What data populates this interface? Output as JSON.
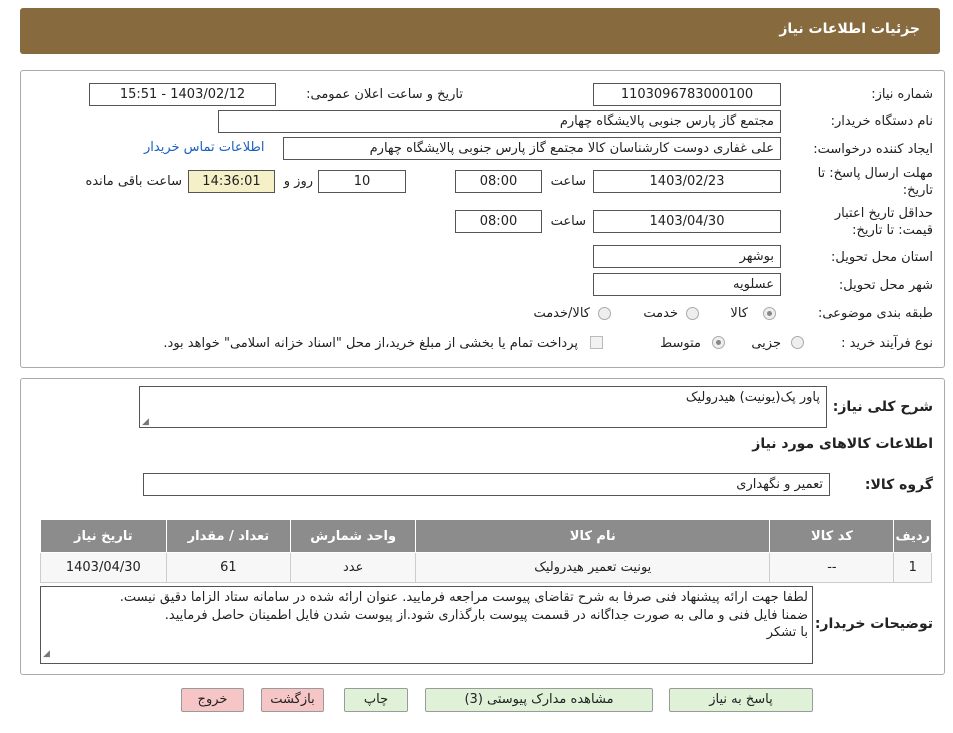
{
  "header": {
    "title": "جزئیات اطلاعات نیاز"
  },
  "form": {
    "need_number_label": "شماره نیاز:",
    "need_number": "1103096783000100",
    "announce_label": "تاریخ و ساعت اعلان عمومی:",
    "announce_value": "1403/02/12 - 15:51",
    "buyer_label": "نام دستگاه خریدار:",
    "buyer_value": "مجتمع گاز پارس جنوبی  پالایشگاه چهارم",
    "creator_label": "ایجاد کننده درخواست:",
    "creator_value": "علی غفاری دوست کارشناسان کالا مجتمع گاز پارس جنوبی  پالایشگاه چهارم",
    "contact_link": "اطلاعات تماس خریدار",
    "deadline_label_1": "مهلت ارسال پاسخ: تا",
    "deadline_label_2": "تاریخ:",
    "deadline_date": "1403/02/23",
    "time_label": "ساعت",
    "deadline_time": "08:00",
    "days_value": "10",
    "days_label": "روز و",
    "remaining_time": "14:36:01",
    "remaining_label": "ساعت باقی مانده",
    "validity_label_1": "حداقل تاریخ اعتبار",
    "validity_label_2": "قیمت: تا تاریخ:",
    "validity_date": "1403/04/30",
    "validity_time": "08:00",
    "province_label": "استان محل تحویل:",
    "province_value": "بوشهر",
    "city_label": "شهر محل تحویل:",
    "city_value": "عسلویه",
    "category_label": "طبقه بندی موضوعی:",
    "category_options": [
      "کالا",
      "خدمت",
      "کالا/خدمت"
    ],
    "category_selected": "کالا",
    "process_label": "نوع فرآیند خرید :",
    "process_options": [
      "جزیی",
      "متوسط"
    ],
    "process_selected": "متوسط",
    "payment_note": "پرداخت تمام یا بخشی از مبلغ خرید،از محل \"اسناد خزانه اسلامی\" خواهد بود."
  },
  "details": {
    "summary_label": "شرح کلی نیاز:",
    "summary_value": "پاور پک(یونیت) هیدرولیک",
    "goods_info_title": "اطلاعات کالاهای مورد نیاز",
    "group_label": "گروه کالا:",
    "group_value": "تعمیر و نگهداری",
    "table": {
      "headers": [
        "ردیف",
        "کد کالا",
        "نام کالا",
        "واحد شمارش",
        "تعداد / مقدار",
        "تاریخ نیاز"
      ],
      "rows": [
        [
          "1",
          "--",
          "یونیت تعمیر هیدرولیک",
          "عدد",
          "61",
          "1403/04/30"
        ]
      ]
    },
    "notes_label": "توضیحات خریدار:",
    "notes_line1": "لطفا جهت ارائه پیشنهاد فنی صرفا به شرح تقاضای پیوست مراجعه فرمایید. عنوان ارائه شده در سامانه ستاد الزاما دقیق نیست.",
    "notes_line2": "ضمنا فایل فنی و مالی به صورت جداگانه در قسمت پیوست بارگذاری شود.از پیوست شدن فایل اطمینان حاصل فرمایید.",
    "notes_line3": "با تشکر"
  },
  "buttons": {
    "reply": "پاسخ به نیاز",
    "attachments": "مشاهده مدارک پیوستی (3)",
    "print": "چاپ",
    "back": "بازگشت",
    "exit": "خروج"
  }
}
